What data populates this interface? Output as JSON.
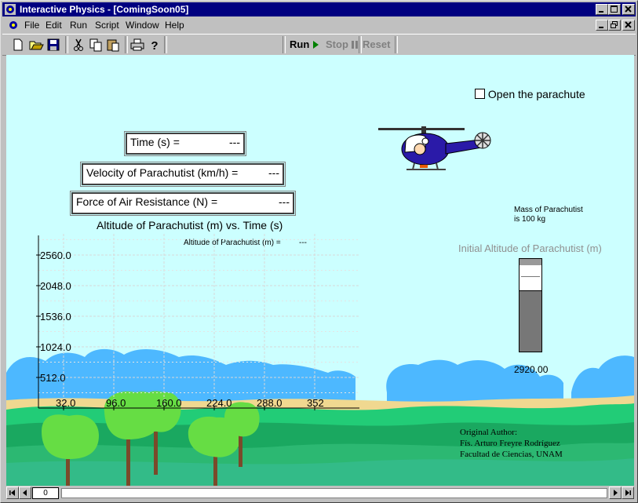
{
  "window": {
    "title": "Interactive Physics - [ComingSoon05]"
  },
  "menu": {
    "items": [
      "File",
      "Edit",
      "Run",
      "Script",
      "Window",
      "Help"
    ]
  },
  "toolbar": {
    "icons": [
      "new-icon",
      "open-icon",
      "save-icon",
      "cut-icon",
      "copy-icon",
      "paste-icon",
      "print-icon",
      "help-icon"
    ],
    "run_label": "Run",
    "stop_label": "Stop",
    "reset_label": "Reset"
  },
  "controls": {
    "parachute_label": "Open the parachute",
    "parachute_checked": false
  },
  "meters": {
    "time": {
      "label": "Time (s) =",
      "value": "---"
    },
    "velocity": {
      "label": "Velocity of Parachutist (km/h) =",
      "value": "---"
    },
    "force": {
      "label": "Force of Air Resistance (N) =",
      "value": "---"
    }
  },
  "mass_note": {
    "line1": "Mass of Parachutist",
    "line2": "is 100 kg"
  },
  "altitude_input": {
    "title": "Initial Altitude of Parachutist (m)",
    "value": "2920.00"
  },
  "chart_data": {
    "type": "line",
    "title": "Altitude of Parachutist (m) vs. Time (s)",
    "readout_label": "Altitude of Parachutist (m) =",
    "readout_value": "---",
    "x_ticks": [
      "32.0",
      "96.0",
      "160.0",
      "224.0",
      "288.0",
      "352"
    ],
    "y_ticks": [
      "512.0",
      "1024.0",
      "1536.0",
      "2048.0",
      "2560.0"
    ],
    "series": [
      {
        "values": []
      }
    ],
    "grid": true
  },
  "credits": {
    "line1": "Original Author:",
    "line2": "Fís. Arturo Freyre Rodríguez",
    "line3": "Facultad de Ciencias, UNAM"
  },
  "scrollbar": {
    "frame": "0"
  },
  "colors": {
    "sky": "#ccffff",
    "titlebar": "#000080",
    "run": "#000000",
    "disabled": "#808080"
  }
}
